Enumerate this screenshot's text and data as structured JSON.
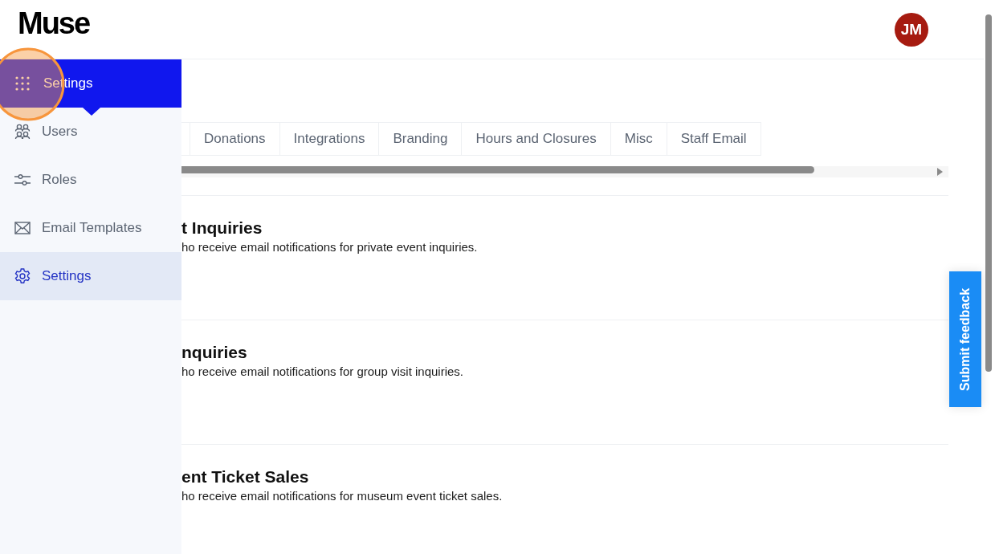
{
  "header": {
    "logo": "Muse",
    "avatar": "JM"
  },
  "sidebar": {
    "heading": "Settings",
    "items": [
      {
        "label": "Users",
        "selected": false
      },
      {
        "label": "Roles",
        "selected": false
      },
      {
        "label": "Email Templates",
        "selected": false
      },
      {
        "label": "Settings",
        "selected": true
      }
    ]
  },
  "tabs": [
    {
      "label": "Donations"
    },
    {
      "label": "Integrations"
    },
    {
      "label": "Branding"
    },
    {
      "label": "Hours and Closures"
    },
    {
      "label": "Misc"
    },
    {
      "label": "Staff Email"
    }
  ],
  "sections": [
    {
      "title": "t Inquiries",
      "description": "ho receive email notifications for private event inquiries."
    },
    {
      "title": "nquiries",
      "description": "ho receive email notifications for group visit inquiries."
    },
    {
      "title": "ent Ticket Sales",
      "description": "ho receive email notifications for museum event ticket sales."
    }
  ],
  "feedback_button": "Submit feedback"
}
